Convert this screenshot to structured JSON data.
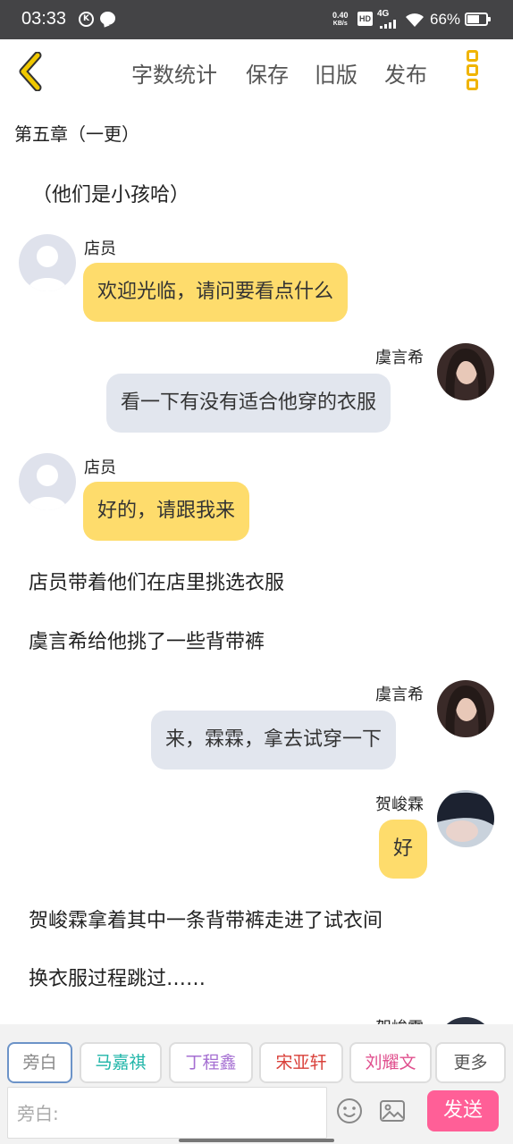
{
  "status_bar": {
    "time": "03:33",
    "k_icon": "K",
    "net_speed_value": "0.40",
    "net_speed_unit": "KB/s",
    "hd": "HD",
    "network": "4G",
    "battery_percent": "66%",
    "battery_level": 0.66,
    "icons": [
      "k-icon",
      "message-icon",
      "signal-icon",
      "wifi-icon",
      "battery-icon"
    ]
  },
  "toolbar": {
    "back_icon": "chevron-left-icon",
    "word_count": "字数统计",
    "save": "保存",
    "old_version": "旧版",
    "publish": "发布",
    "more_icon": "more-vertical-icon"
  },
  "chapter_title": "第五章（一更）",
  "story": {
    "narration_1": "（他们是小孩哈）",
    "msg_1": {
      "name": "店员",
      "text": "欢迎光临，请问要看点什么"
    },
    "msg_2": {
      "name": "虞言希",
      "text": "看一下有没有适合他穿的衣服"
    },
    "msg_3": {
      "name": "店员",
      "text": "好的，请跟我来"
    },
    "narration_2": "店员带着他们在店里挑选衣服",
    "narration_3": "虞言希给他挑了一些背带裤",
    "msg_4": {
      "name": "虞言希",
      "text": "来，霖霖，拿去试穿一下"
    },
    "msg_5": {
      "name": "贺峻霖",
      "text": "好"
    },
    "narration_4": "贺峻霖拿着其中一条背带裤走进了试衣间",
    "narration_5": "换衣服过程跳过……",
    "partial_name": "贺峻霖"
  },
  "characters": [
    {
      "label": "旁白",
      "color": "#888888"
    },
    {
      "label": "马嘉祺",
      "color": "#1fb5a8"
    },
    {
      "label": "丁程鑫",
      "color": "#a56fd2"
    },
    {
      "label": "宋亚轩",
      "color": "#d9403a"
    },
    {
      "label": "刘耀文",
      "color": "#e0508e"
    },
    {
      "label": "更多",
      "color": "#555555"
    }
  ],
  "input": {
    "placeholder": "旁白:"
  },
  "send_label": "发送",
  "colors": {
    "accent_yellow": "#fedc6c",
    "send_pink": "#ff5f97",
    "back_icon": "#f0b400"
  }
}
